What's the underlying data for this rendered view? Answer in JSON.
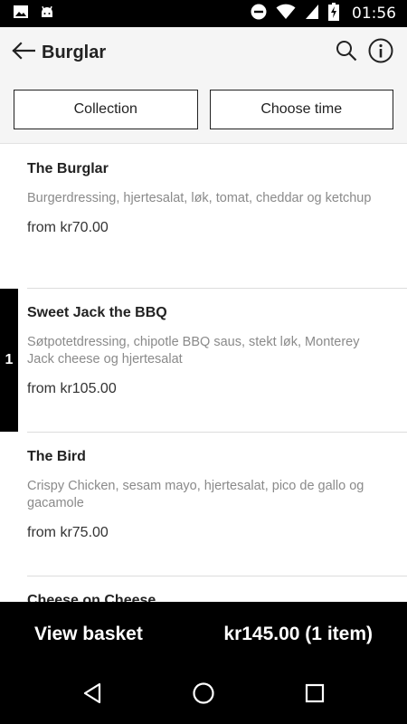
{
  "status_bar": {
    "time": "01:56",
    "icons": [
      "image-icon",
      "android-icon",
      "do-not-disturb-icon",
      "wifi-icon",
      "battery-charging-icon"
    ]
  },
  "app_bar": {
    "title": "Burglar",
    "icons": [
      "back-arrow-icon",
      "search-icon",
      "info-icon"
    ]
  },
  "options": {
    "collection_label": "Collection",
    "time_label": "Choose time"
  },
  "menu": {
    "items": [
      {
        "name": "The Burglar",
        "description": "Burgerdressing, hjertesalat, løk, tomat, cheddar og ketchup",
        "price": "from kr70.00"
      },
      {
        "name": "Sweet Jack the BBQ",
        "description": "Søtpotetdressing, chipotle BBQ saus, stekt løk, Monterey Jack cheese og hjertesalat",
        "price": "from kr105.00",
        "quantity": "1"
      },
      {
        "name": "The Bird",
        "description": "Crispy Chicken, sesam mayo, hjertesalat, pico de gallo og gacamole",
        "price": "from kr75.00"
      },
      {
        "name": "Cheese on Cheese"
      }
    ]
  },
  "basket": {
    "label": "View basket",
    "total": "kr145.00 (1 item)"
  },
  "nav_bar": {
    "icons": [
      "back-triangle-icon",
      "home-circle-icon",
      "recents-square-icon"
    ]
  }
}
